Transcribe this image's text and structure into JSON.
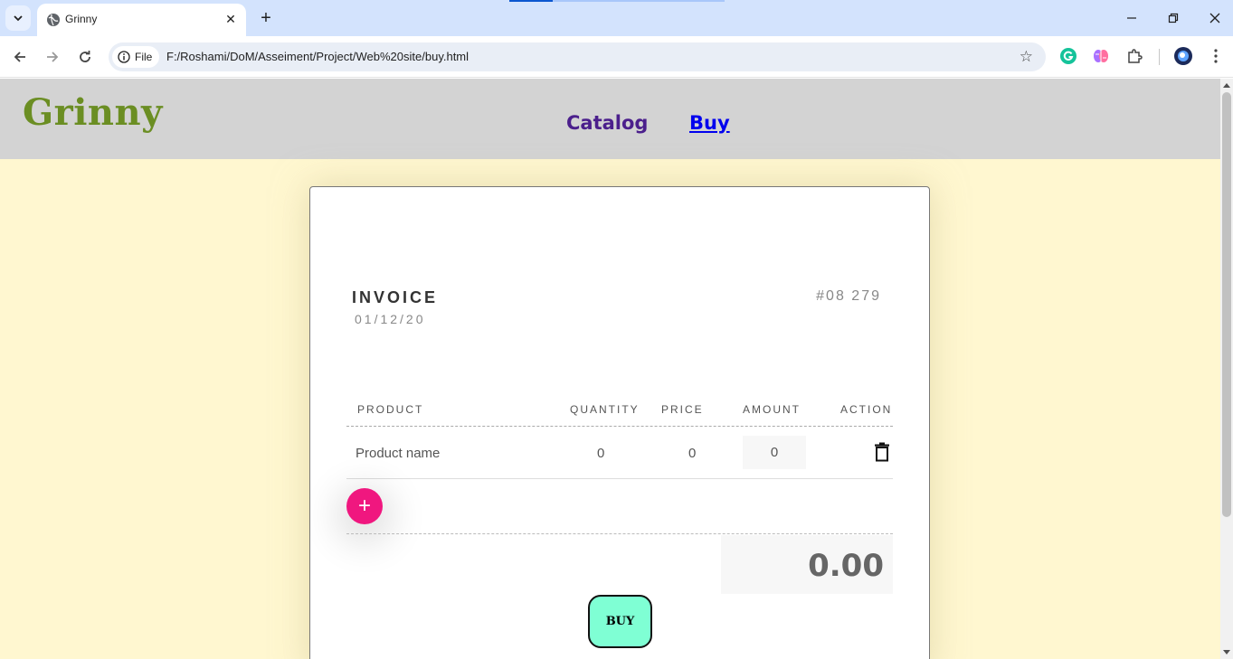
{
  "browser": {
    "tab_title": "Grinny",
    "site_chip": "File",
    "url": "F:/Roshami/DoM/Asseiment/Project/Web%20site/buy.html"
  },
  "header": {
    "logo": "Grinny",
    "nav": [
      {
        "label": "Catalog"
      },
      {
        "label": "Buy"
      }
    ]
  },
  "invoice": {
    "title": "INVOICE",
    "date": "01/12/20",
    "number": "#08 279",
    "columns": [
      "PRODUCT",
      "QUANTITY",
      "PRICE",
      "AMOUNT",
      "ACTION"
    ],
    "rows": [
      {
        "product": "Product name",
        "quantity": "0",
        "price": "0",
        "amount": "0"
      }
    ],
    "add_label": "+",
    "total": "0.00",
    "buy_label": "BUY"
  },
  "colors": {
    "page_bg": "#fff7d0",
    "header_bg": "#d3d3d3",
    "logo": "#6b8e23",
    "add_button": "#f0177f",
    "buy_button": "#7fffd4"
  }
}
